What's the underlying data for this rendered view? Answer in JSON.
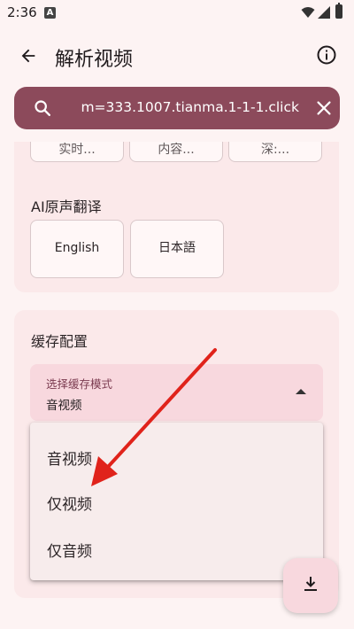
{
  "status_bar": {
    "time": "2:36",
    "app_badge": "A"
  },
  "top_bar": {
    "title": "解析视频"
  },
  "search": {
    "value": "m=333.1007.tianma.1-1-1.click"
  },
  "card_top": {
    "cut_chips": [
      "实时...",
      "内容...",
      "深:..."
    ],
    "ai_label": "AI原声翻译",
    "languages": [
      "English",
      "日本語"
    ]
  },
  "cache": {
    "title": "缓存配置",
    "select_label": "选择缓存模式",
    "select_value": "音视频",
    "options": [
      "音视频",
      "仅视频",
      "仅音频"
    ]
  },
  "colors": {
    "accent": "#8c4a5b",
    "arrow": "#e0231b",
    "surface": "#fbe9ea"
  }
}
